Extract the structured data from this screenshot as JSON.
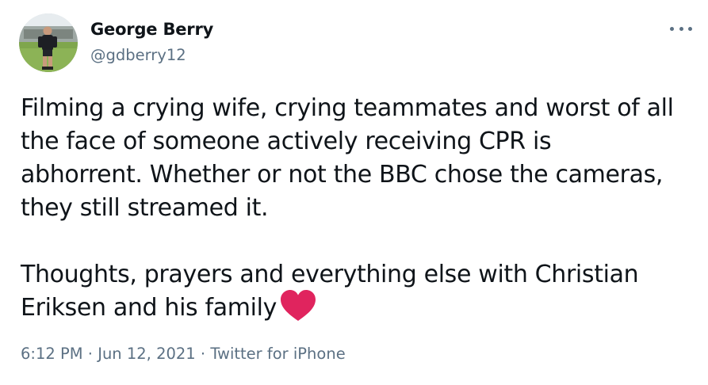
{
  "author": {
    "name": "George Berry",
    "handle": "@gdberry12"
  },
  "tweet": {
    "lines_para1": [
      "Filming a crying wife, crying teammates and worst of all",
      "the face of someone actively receiving CPR is",
      "abhorrent. Whether or not the BBC chose the cameras,",
      "they still streamed it."
    ],
    "lines_para2": [
      "Thoughts, prayers and everything else with Christian",
      "Eriksen and his family"
    ],
    "emoji": "red-heart-icon"
  },
  "meta": {
    "time": "6:12 PM",
    "separator": " · ",
    "date": "Jun 12, 2021",
    "source": "Twitter for iPhone"
  },
  "colors": {
    "text": "#0f1419",
    "secondary": "#5b7083",
    "heart": "#e0245e"
  },
  "icons": {
    "more": "more-options-icon",
    "avatar": "profile-avatar"
  }
}
